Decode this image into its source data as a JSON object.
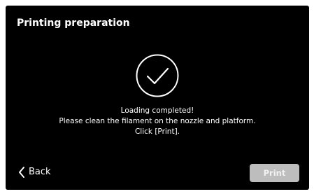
{
  "header": {
    "title": "Printing preparation"
  },
  "status": {
    "icon": "check-circle-icon",
    "lines": [
      "Loading completed!",
      "Please clean the filament on the nozzle and platform.",
      "Click [Print]."
    ]
  },
  "footer": {
    "back_label": "Back",
    "back_icon": "chevron-left-icon",
    "print_label": "Print"
  },
  "colors": {
    "background": "#000000",
    "text": "#ffffff",
    "print_button_disabled": "#bdbdbd"
  }
}
